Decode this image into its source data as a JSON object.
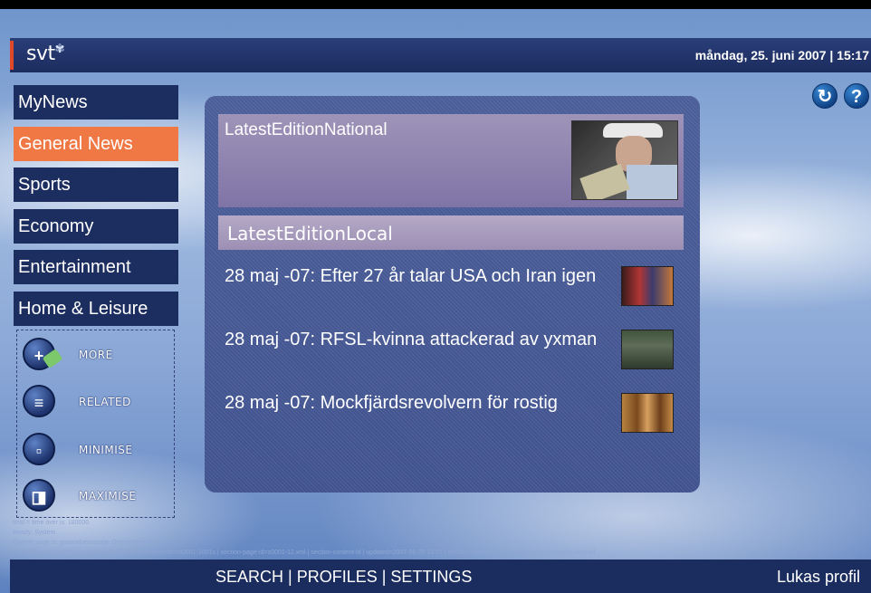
{
  "header": {
    "logo_text": "svt",
    "logo_mark": "✾",
    "datetime": "måndag, 25. juni 2007 | 15:17"
  },
  "nav": {
    "items": [
      {
        "label": "MyNews",
        "active": false
      },
      {
        "label": "General News",
        "active": true
      },
      {
        "label": "Sports",
        "active": false
      },
      {
        "label": "Economy",
        "active": false
      },
      {
        "label": "Entertainment",
        "active": false
      },
      {
        "label": "Home & Leisure",
        "active": false
      }
    ]
  },
  "tools": {
    "more": {
      "label": "MORE",
      "icon": "plus-icon"
    },
    "related": {
      "label": "RELATED",
      "icon": "document-icon"
    },
    "minimise": {
      "label": "MINIMISE",
      "icon": "minimise-icon"
    },
    "maximise": {
      "label": "MAXIMISE",
      "icon": "maximise-icon"
    }
  },
  "debug": {
    "line1": "tmst = time over is: 180000",
    "line2": "Ready: System",
    "line3": "Current page is: generalnewspage.GeneralNews",
    "line4": "Current content: section.page.story1-title.show.section-id=vs0001-1001s | section-page-id=s0001-12.xml | section-content-id | updated=2007-06-25 15:17 | section-type=general | page=generalnews/thumbnail"
  },
  "panel": {
    "national_title": "LatestEditionNational",
    "local_title": "LatestEditionLocal",
    "news": [
      {
        "headline": "28 maj -07: Efter 27 år talar USA och Iran igen"
      },
      {
        "headline": "28 maj -07: RFSL-kvinna attackerad av yxman"
      },
      {
        "headline": "28 maj -07: Mockfjärdsrevolvern för rostig"
      }
    ]
  },
  "top_icons": {
    "refresh": "refresh-icon",
    "help": "?"
  },
  "footer": {
    "search": "SEARCH",
    "sep1": " | ",
    "profiles": "PROFILES",
    "sep2": " | ",
    "settings": "SETTINGS",
    "profile": "Lukas profil"
  },
  "colors": {
    "bar": "#1b2c5e",
    "active": "#f07844",
    "accent_red": "#e0482a"
  }
}
